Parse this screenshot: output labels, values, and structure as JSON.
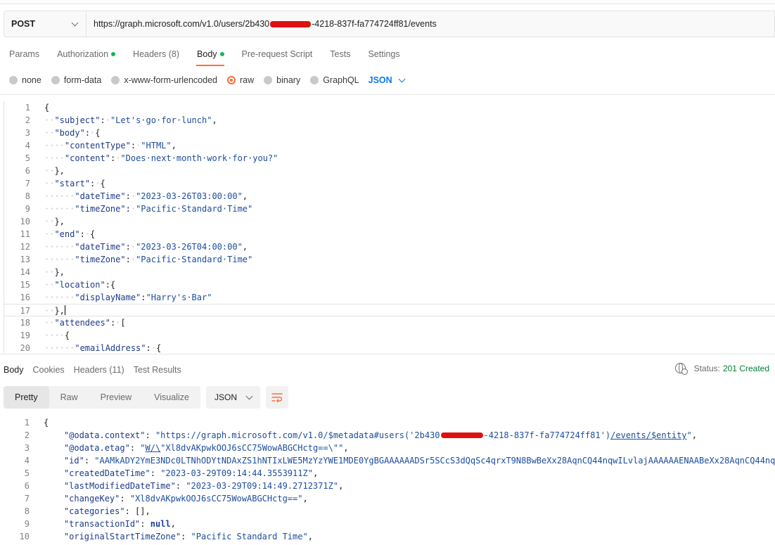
{
  "request": {
    "method": "POST",
    "url_prefix": "https://graph.microsoft.com/v1.0/users/2b430",
    "url_suffix": "-4218-837f-fa774724ff81/events"
  },
  "tabs": [
    {
      "label": "Params"
    },
    {
      "label": "Authorization"
    },
    {
      "label": "Headers (8)"
    },
    {
      "label": "Body"
    },
    {
      "label": "Pre-request Script"
    },
    {
      "label": "Tests"
    },
    {
      "label": "Settings"
    }
  ],
  "body_types": [
    "none",
    "form-data",
    "x-www-form-urlencoded",
    "raw",
    "binary",
    "GraphQL"
  ],
  "body_format": "JSON",
  "request_body": {
    "line_numbers": [
      "1",
      "2",
      "3",
      "4",
      "5",
      "6",
      "7",
      "8",
      "9",
      "10",
      "11",
      "12",
      "13",
      "14",
      "15",
      "16",
      "17",
      "18",
      "19",
      "20"
    ]
  },
  "response": {
    "tabs": [
      "Body",
      "Cookies",
      "Headers (11)",
      "Test Results"
    ],
    "status_label": "Status:",
    "status_value": "201 Created",
    "views": [
      "Pretty",
      "Raw",
      "Preview",
      "Visualize"
    ],
    "format": "JSON",
    "line_numbers": [
      "1",
      "2",
      "3",
      "4",
      "5",
      "6",
      "7",
      "8",
      "9",
      "10"
    ]
  },
  "colors": {
    "accent": "#ff6c37",
    "success": "#0cbb52",
    "link": "#097bed",
    "redaction": "#e01010"
  }
}
